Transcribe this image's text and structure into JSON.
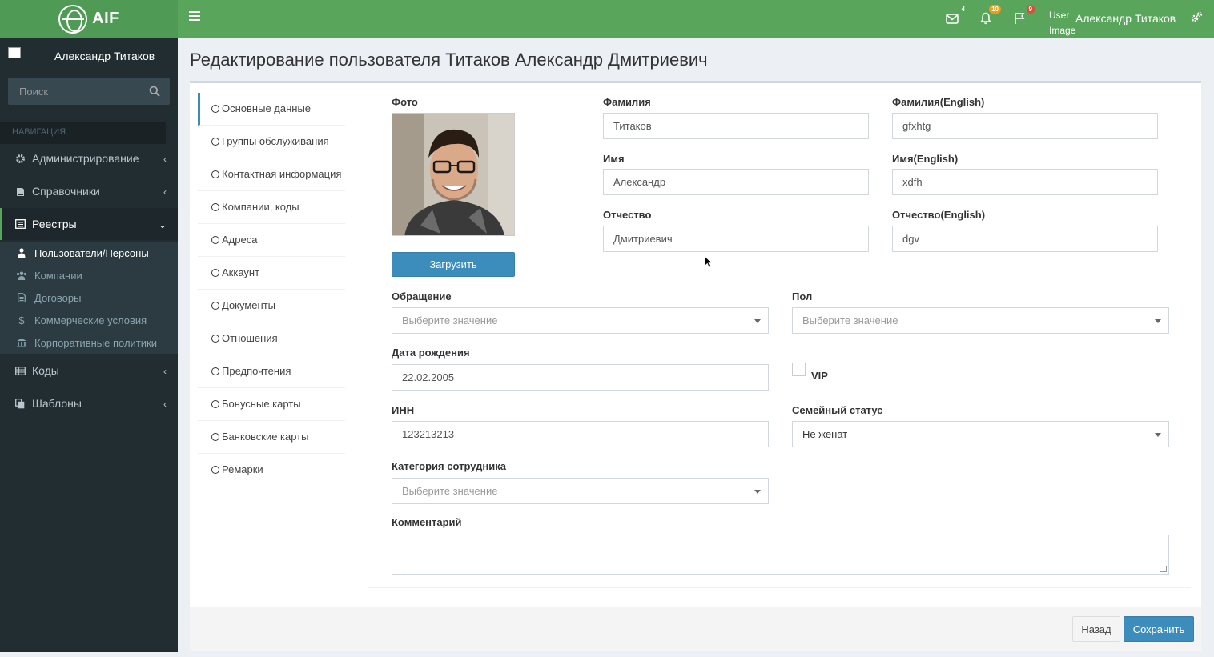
{
  "app": {
    "logo_text": "AIF"
  },
  "header": {
    "mail_count": "4",
    "notifications_count": "10",
    "flags_count": "9",
    "user_image_alt": "User Image",
    "user_name": "Александр Титаков"
  },
  "sidebar": {
    "user_name": "Александр Титаков",
    "search_placeholder": "Поиск",
    "nav_header": "НАВИГАЦИЯ",
    "items": [
      {
        "label": "Администрирование",
        "icon": "gear-icon"
      },
      {
        "label": "Справочники",
        "icon": "book-icon"
      },
      {
        "label": "Реестры",
        "icon": "list-alt-icon"
      },
      {
        "label": "Коды",
        "icon": "table-icon"
      },
      {
        "label": "Шаблоны",
        "icon": "copy-icon"
      }
    ],
    "subitems": [
      {
        "label": "Пользователи/Персоны",
        "icon": "user-icon"
      },
      {
        "label": "Компании",
        "icon": "users-icon"
      },
      {
        "label": "Договоры",
        "icon": "file-icon"
      },
      {
        "label": "Коммерческие условия",
        "icon": "dollar-icon"
      },
      {
        "label": "Корпоративные политики",
        "icon": "bank-icon"
      }
    ]
  },
  "page": {
    "title": "Редактирование пользователя Титаков Александр Дмитриевич"
  },
  "tabs": [
    "Основные данные",
    "Группы обслуживания",
    "Контактная информация",
    "Компании, коды",
    "Адреса",
    "Аккаунт",
    "Документы",
    "Отношения",
    "Предпочтения",
    "Бонусные карты",
    "Банковские карты",
    "Ремарки"
  ],
  "form": {
    "photo_label": "Фото",
    "upload_button": "Загрузить",
    "last_name_label": "Фамилия",
    "last_name_value": "Титаков",
    "last_name_en_label": "Фамилия(English)",
    "last_name_en_value": "gfxhtg",
    "first_name_label": "Имя",
    "first_name_value": "Александр",
    "first_name_en_label": "Имя(English)",
    "first_name_en_value": "xdfh",
    "middle_name_label": "Отчество",
    "middle_name_value": "Дмитриевич",
    "middle_name_en_label": "Отчество(English)",
    "middle_name_en_value": "dgv",
    "salutation_label": "Обращение",
    "salutation_placeholder": "Выберите значение",
    "gender_label": "Пол",
    "gender_placeholder": "Выберите значение",
    "birth_date_label": "Дата рождения",
    "birth_date_value": "22.02.2005",
    "vip_label": "VIP",
    "inn_label": "ИНН",
    "inn_value": "123213213",
    "marital_label": "Семейный статус",
    "marital_value": "Не женат",
    "category_label": "Категория сотрудника",
    "category_placeholder": "Выберите значение",
    "comment_label": "Комментарий",
    "comment_value": ""
  },
  "footer": {
    "back_button": "Назад",
    "save_button": "Сохранить"
  },
  "colors": {
    "header_green": "#5aa55c",
    "logo_green": "#4f9b55",
    "sidebar_dark": "#222d32",
    "primary_blue": "#3c8dbc"
  }
}
